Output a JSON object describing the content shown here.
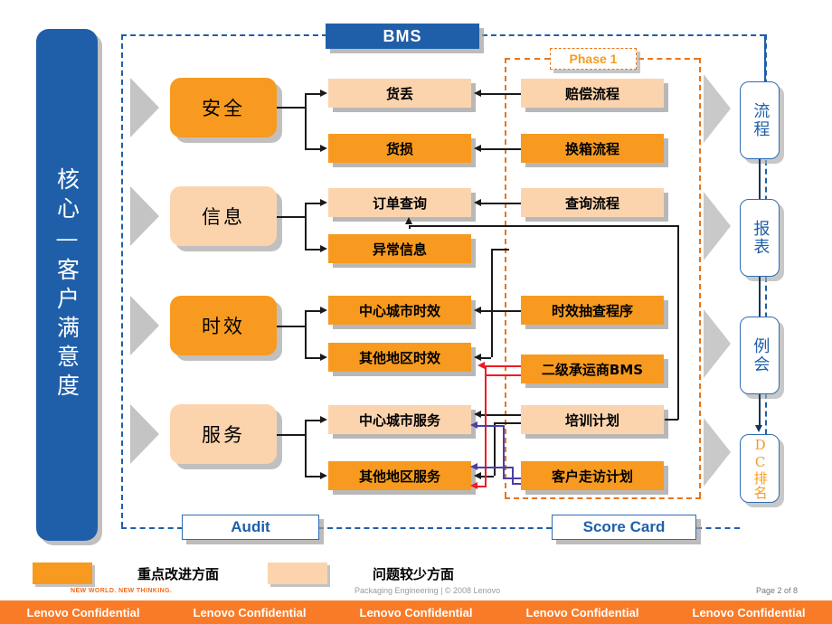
{
  "header": {
    "bms_label": "BMS",
    "phase_label": "Phase 1"
  },
  "pillar": {
    "label": "核心—客户满意度"
  },
  "categories": [
    {
      "label": "安全",
      "tone": "dark"
    },
    {
      "label": "信息",
      "tone": "light"
    },
    {
      "label": "时效",
      "tone": "dark"
    },
    {
      "label": "服务",
      "tone": "light"
    }
  ],
  "metrics": [
    {
      "label": "货丢",
      "tone": "light"
    },
    {
      "label": "货损",
      "tone": "dark"
    },
    {
      "label": "订单查询",
      "tone": "light"
    },
    {
      "label": "异常信息",
      "tone": "dark"
    },
    {
      "label": "中心城市时效",
      "tone": "dark"
    },
    {
      "label": "其他地区时效",
      "tone": "dark"
    },
    {
      "label": "中心城市服务",
      "tone": "light"
    },
    {
      "label": "其他地区服务",
      "tone": "dark"
    }
  ],
  "initiatives": [
    {
      "label": "赔偿流程",
      "tone": "light"
    },
    {
      "label": "换箱流程",
      "tone": "dark"
    },
    {
      "label": "查询流程",
      "tone": "light"
    },
    {
      "label": "时效抽查程序",
      "tone": "dark"
    },
    {
      "label": "二级承运商BMS",
      "tone": "dark"
    },
    {
      "label": "培训计划",
      "tone": "light"
    },
    {
      "label": "客户走访计划",
      "tone": "dark"
    }
  ],
  "outputs": [
    {
      "label": "流程",
      "style": "blue"
    },
    {
      "label": "报表",
      "style": "blue"
    },
    {
      "label": "例会",
      "style": "blue"
    },
    {
      "label": "DC排名",
      "style": "orange"
    }
  ],
  "footer_boxes": {
    "audit_label": "Audit",
    "score_card_label": "Score Card"
  },
  "legend": [
    {
      "swatch": "dark",
      "label": "重点改进方面"
    },
    {
      "swatch": "light",
      "label": "问题较少方面"
    }
  ],
  "branding": {
    "tagline": "NEW WORLD. NEW THINKING.",
    "credit": "Packaging Engineering | © 2008 Lenovo",
    "page": "Page 2 of 8",
    "confidential": "Lenovo Confidential",
    "confidential_repeat": 5
  },
  "colors": {
    "brand_blue": "#1F5FA9",
    "accent_orange_dark": "#F79A1F",
    "accent_orange_light": "#FBD4AE",
    "bar_orange": "#FA7B27",
    "red_link": "#ED1C24",
    "purple_link": "#4B3FA6"
  }
}
